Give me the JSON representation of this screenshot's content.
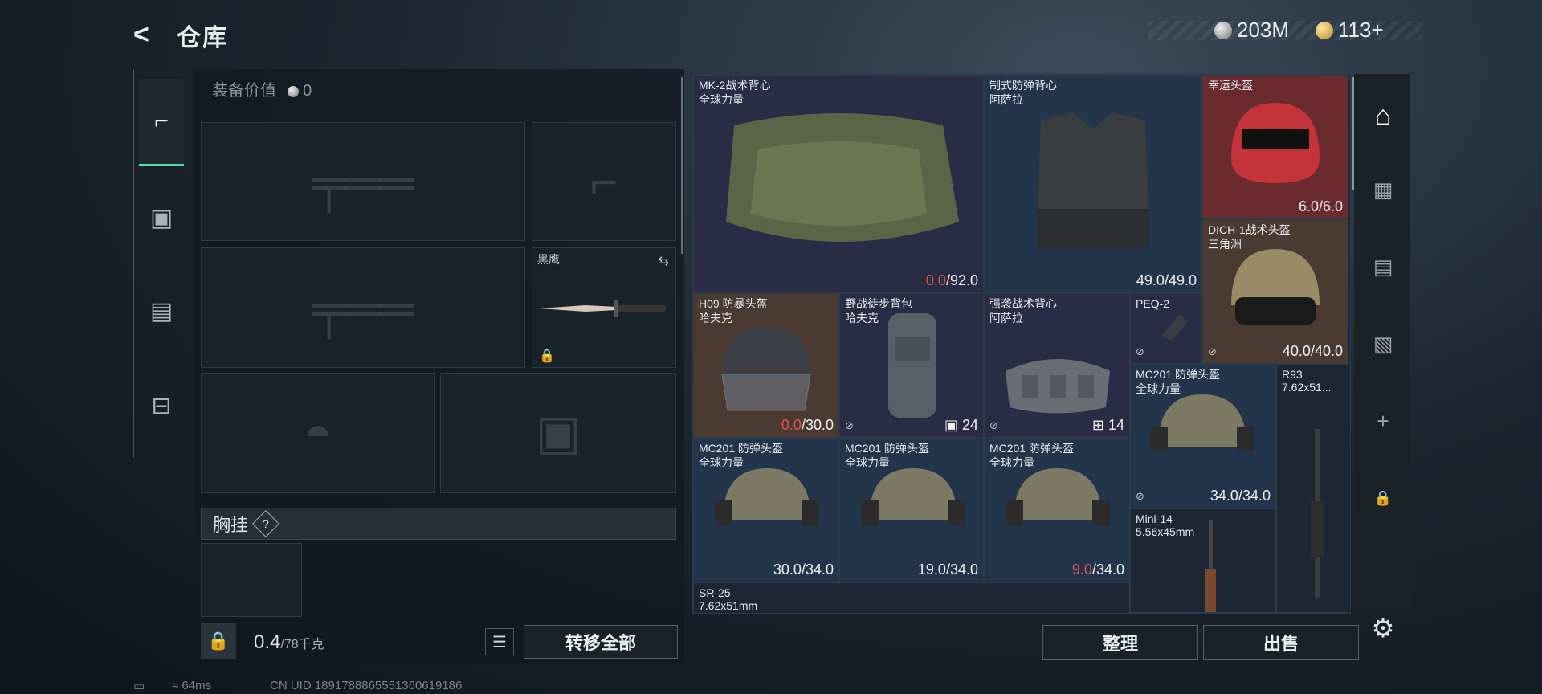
{
  "header": {
    "back_label": "<",
    "title": "仓库"
  },
  "currencies": [
    {
      "icon": "silver-coin-icon",
      "value": "203M"
    },
    {
      "icon": "gold-coin-icon",
      "value": "113+"
    }
  ],
  "equipment": {
    "value_label": "装备价值",
    "value": "0",
    "knife_slot": {
      "label": "黑鹰"
    },
    "chest_label": "胸挂",
    "chest_help": "?",
    "weight_value": "0.4",
    "weight_max": "/78千克",
    "transfer_all": "转移全部"
  },
  "grid_items": [
    {
      "name": "MK-2战术背心",
      "sub": "全球力量",
      "dur_cur": "0.0",
      "dur_max": "/92.0",
      "cur_red": true
    },
    {
      "name": "制式防弹背心",
      "sub": "阿萨拉",
      "dur_cur": "49.0",
      "dur_max": "/49.0",
      "cur_red": false
    },
    {
      "name": "幸运头盔",
      "sub": "",
      "dur_cur": "6.0",
      "dur_max": "/6.0",
      "cur_red": false
    },
    {
      "name": "DICH-1战术头盔",
      "sub": "三角洲",
      "dur_cur": "40.0",
      "dur_max": "/40.0",
      "cur_red": false
    },
    {
      "name": "H09 防暴头盔",
      "sub": "哈夫克",
      "dur_cur": "0.0",
      "dur_max": "/30.0",
      "cur_red": true
    },
    {
      "name": "野战徒步背包",
      "sub": "哈夫克",
      "count": "24"
    },
    {
      "name": "强袭战术背心",
      "sub": "阿萨拉",
      "count": "14"
    },
    {
      "name": "PEQ-2",
      "sub": ""
    },
    {
      "name": "MC201 防弹头盔",
      "sub": "全球力量",
      "dur_cur": "34.0",
      "dur_max": "/34.0",
      "cur_red": false
    },
    {
      "name": "R93",
      "sub": "7.62x51..."
    },
    {
      "name": "MC201 防弹头盔",
      "sub": "全球力量",
      "dur_cur": "30.0",
      "dur_max": "/34.0",
      "cur_red": false
    },
    {
      "name": "MC201 防弹头盔",
      "sub": "全球力量",
      "dur_cur": "19.0",
      "dur_max": "/34.0",
      "cur_red": false
    },
    {
      "name": "MC201 防弹头盔",
      "sub": "全球力量",
      "dur_cur": "9.0",
      "dur_max": "/34.0",
      "cur_red": true
    },
    {
      "name": "Mini-14",
      "sub": "5.56x45mm"
    },
    {
      "name": "SR-25",
      "sub": "7.62x51mm"
    }
  ],
  "actions": {
    "sort": "整理",
    "sell": "出售"
  },
  "footer": {
    "ping": "64ms",
    "uid": "CN UID 1891788865551360619186"
  },
  "colors": {
    "accent": "#4de0a0",
    "red_value": "#e25050",
    "rare_red": "#6a2b2e",
    "rare_purple": "#2a2b45",
    "rare_blue": "#22354a"
  }
}
